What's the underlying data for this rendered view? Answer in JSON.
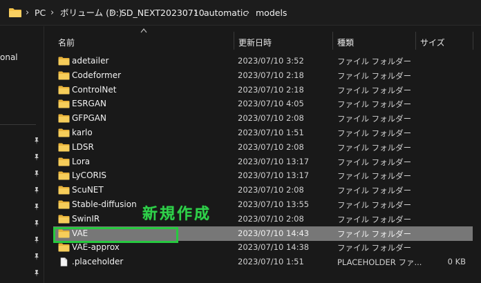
{
  "breadcrumb": {
    "items": [
      "PC",
      "ボリューム (D:)",
      "SD_NEXT20230710",
      "automatic",
      "models"
    ],
    "separator": "›"
  },
  "navpane": {
    "partial_label": "onal"
  },
  "columns": {
    "name": "名前",
    "date": "更新日時",
    "type": "種類",
    "size": "サイズ"
  },
  "files": [
    {
      "name": "adetailer",
      "date": "2023/07/10 3:52",
      "type": "ファイル フォルダー",
      "size": "",
      "icon": "folder-icon"
    },
    {
      "name": "Codeformer",
      "date": "2023/07/10 2:18",
      "type": "ファイル フォルダー",
      "size": "",
      "icon": "folder-icon"
    },
    {
      "name": "ControlNet",
      "date": "2023/07/10 2:18",
      "type": "ファイル フォルダー",
      "size": "",
      "icon": "folder-icon"
    },
    {
      "name": "ESRGAN",
      "date": "2023/07/10 4:05",
      "type": "ファイル フォルダー",
      "size": "",
      "icon": "folder-icon"
    },
    {
      "name": "GFPGAN",
      "date": "2023/07/10 2:08",
      "type": "ファイル フォルダー",
      "size": "",
      "icon": "folder-icon"
    },
    {
      "name": "karlo",
      "date": "2023/07/10 1:51",
      "type": "ファイル フォルダー",
      "size": "",
      "icon": "folder-icon"
    },
    {
      "name": "LDSR",
      "date": "2023/07/10 2:08",
      "type": "ファイル フォルダー",
      "size": "",
      "icon": "folder-icon"
    },
    {
      "name": "Lora",
      "date": "2023/07/10 13:17",
      "type": "ファイル フォルダー",
      "size": "",
      "icon": "folder-icon"
    },
    {
      "name": "LyCORIS",
      "date": "2023/07/10 13:17",
      "type": "ファイル フォルダー",
      "size": "",
      "icon": "folder-icon"
    },
    {
      "name": "ScuNET",
      "date": "2023/07/10 2:08",
      "type": "ファイル フォルダー",
      "size": "",
      "icon": "folder-icon"
    },
    {
      "name": "Stable-diffusion",
      "date": "2023/07/10 13:55",
      "type": "ファイル フォルダー",
      "size": "",
      "icon": "folder-icon"
    },
    {
      "name": "SwinIR",
      "date": "2023/07/10 2:08",
      "type": "ファイル フォルダー",
      "size": "",
      "icon": "folder-icon"
    },
    {
      "name": "VAE",
      "date": "2023/07/10 14:43",
      "type": "ファイル フォルダー",
      "size": "",
      "icon": "folder-icon",
      "selected": true
    },
    {
      "name": "VAE-approx",
      "date": "2023/07/10 14:38",
      "type": "ファイル フォルダー",
      "size": "",
      "icon": "folder-icon"
    },
    {
      "name": ".placeholder",
      "date": "2023/07/10 1:51",
      "type": "PLACEHOLDER ファ...",
      "size": "0 KB",
      "icon": "file-icon"
    }
  ],
  "annotation": {
    "text": "新規作成",
    "color": "#27c93f"
  },
  "colors": {
    "background": "#191919",
    "folder": "#f4c34a",
    "selected_row": "#777777"
  }
}
